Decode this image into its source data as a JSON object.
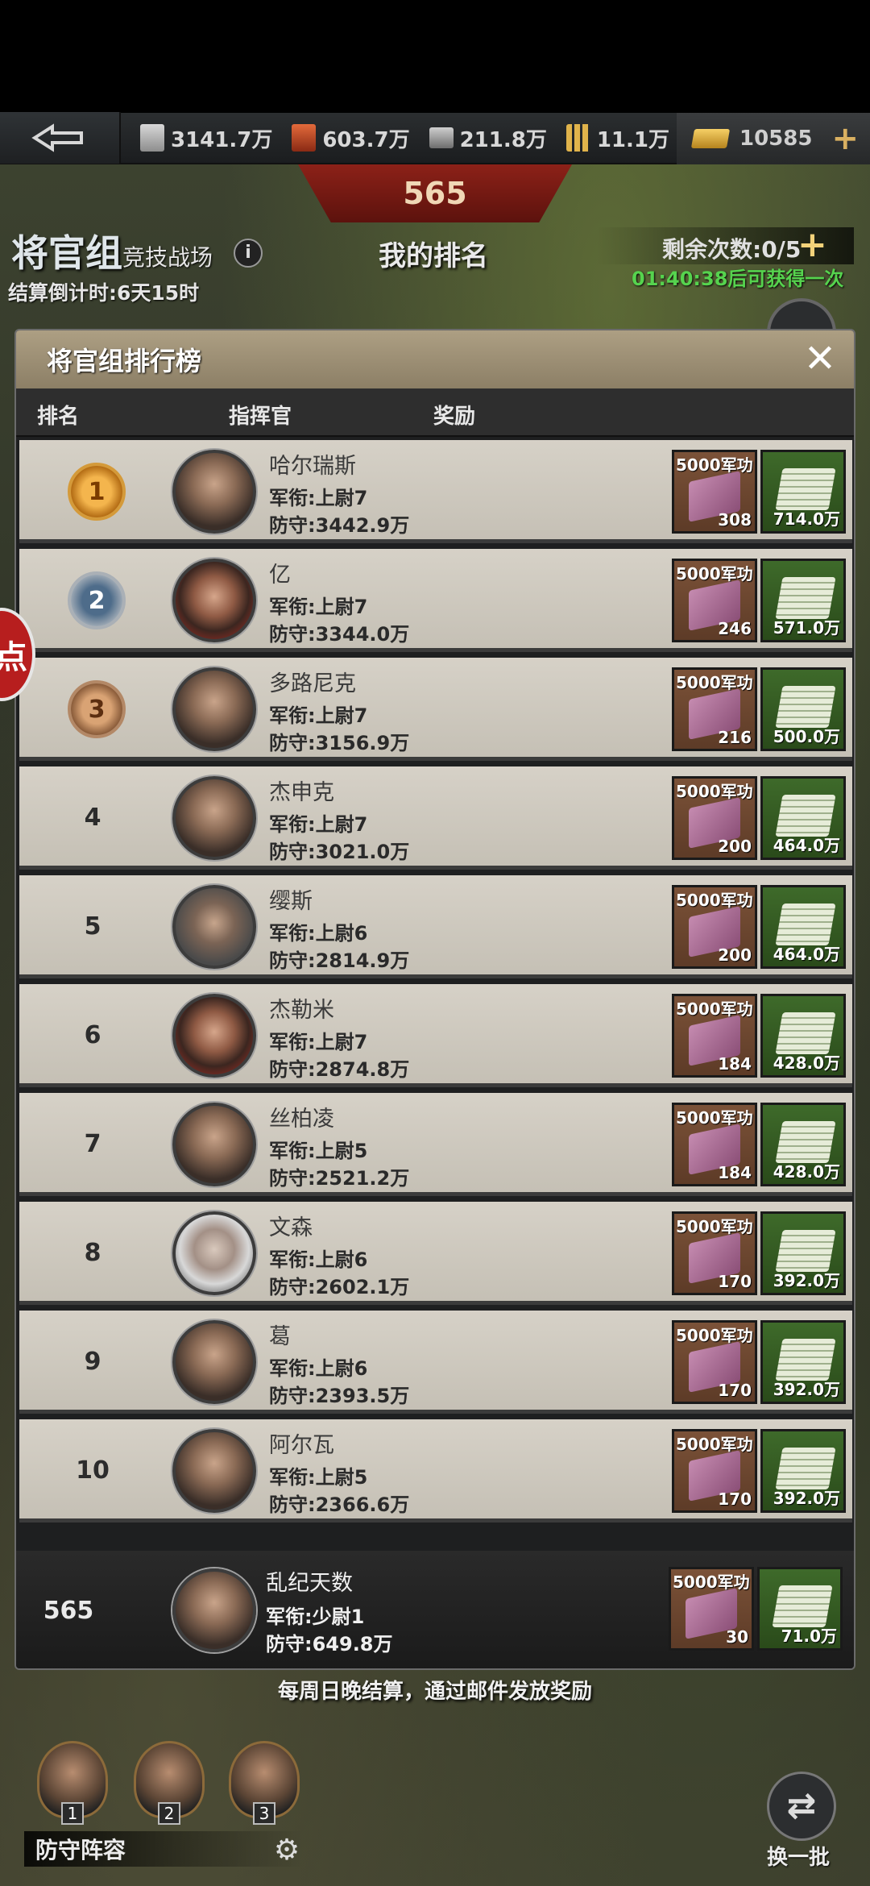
{
  "resources": {
    "cash": "3141.7万",
    "oil": "603.7万",
    "steel": "211.8万",
    "ammo": "11.1万",
    "gold": "10585"
  },
  "header": {
    "rank_value": "565",
    "group_title": "将官组",
    "group_subtitle": "竞技战场",
    "my_rank_label": "我的排名",
    "remaining": "剩余次数:0/5",
    "regen_note": "01:40:38后可获得一次",
    "countdown": "结算倒计时:6天15时",
    "side_badge": "点"
  },
  "panel": {
    "title": "将官组排行榜",
    "columns": {
      "rank": "排名",
      "commander": "指挥官",
      "reward": "奖励"
    },
    "reward_book_label": "5000军功",
    "rows": [
      {
        "rank": "1",
        "name": "哈尔瑞斯",
        "title": "军衔:上尉7",
        "defense": "防守:3442.9万",
        "book": "308",
        "cash": "714.0万"
      },
      {
        "rank": "2",
        "name": "亿",
        "title": "军衔:上尉7",
        "defense": "防守:3344.0万",
        "book": "246",
        "cash": "571.0万"
      },
      {
        "rank": "3",
        "name": "多路尼克",
        "title": "军衔:上尉7",
        "defense": "防守:3156.9万",
        "book": "216",
        "cash": "500.0万"
      },
      {
        "rank": "4",
        "name": "杰申克",
        "title": "军衔:上尉7",
        "defense": "防守:3021.0万",
        "book": "200",
        "cash": "464.0万"
      },
      {
        "rank": "5",
        "name": "缨斯",
        "title": "军衔:上尉6",
        "defense": "防守:2814.9万",
        "book": "200",
        "cash": "464.0万"
      },
      {
        "rank": "6",
        "name": "杰勒米",
        "title": "军衔:上尉7",
        "defense": "防守:2874.8万",
        "book": "184",
        "cash": "428.0万"
      },
      {
        "rank": "7",
        "name": "丝柏凌",
        "title": "军衔:上尉5",
        "defense": "防守:2521.2万",
        "book": "184",
        "cash": "428.0万"
      },
      {
        "rank": "8",
        "name": "文森",
        "title": "军衔:上尉6",
        "defense": "防守:2602.1万",
        "book": "170",
        "cash": "392.0万"
      },
      {
        "rank": "9",
        "name": "葛",
        "title": "军衔:上尉6",
        "defense": "防守:2393.5万",
        "book": "170",
        "cash": "392.0万"
      },
      {
        "rank": "10",
        "name": "阿尔瓦",
        "title": "军衔:上尉5",
        "defense": "防守:2366.6万",
        "book": "170",
        "cash": "392.0万"
      }
    ],
    "me": {
      "rank": "565",
      "name": "乱纪天数",
      "title": "军衔:少尉1",
      "defense": "防守:649.8万",
      "book": "30",
      "cash": "71.0万"
    }
  },
  "footer_note": "每周日晚结算，通过邮件发放奖励",
  "lineup": {
    "label": "防守阵容",
    "slots": [
      "1",
      "2",
      "3"
    ]
  },
  "swap_label": "换一批"
}
